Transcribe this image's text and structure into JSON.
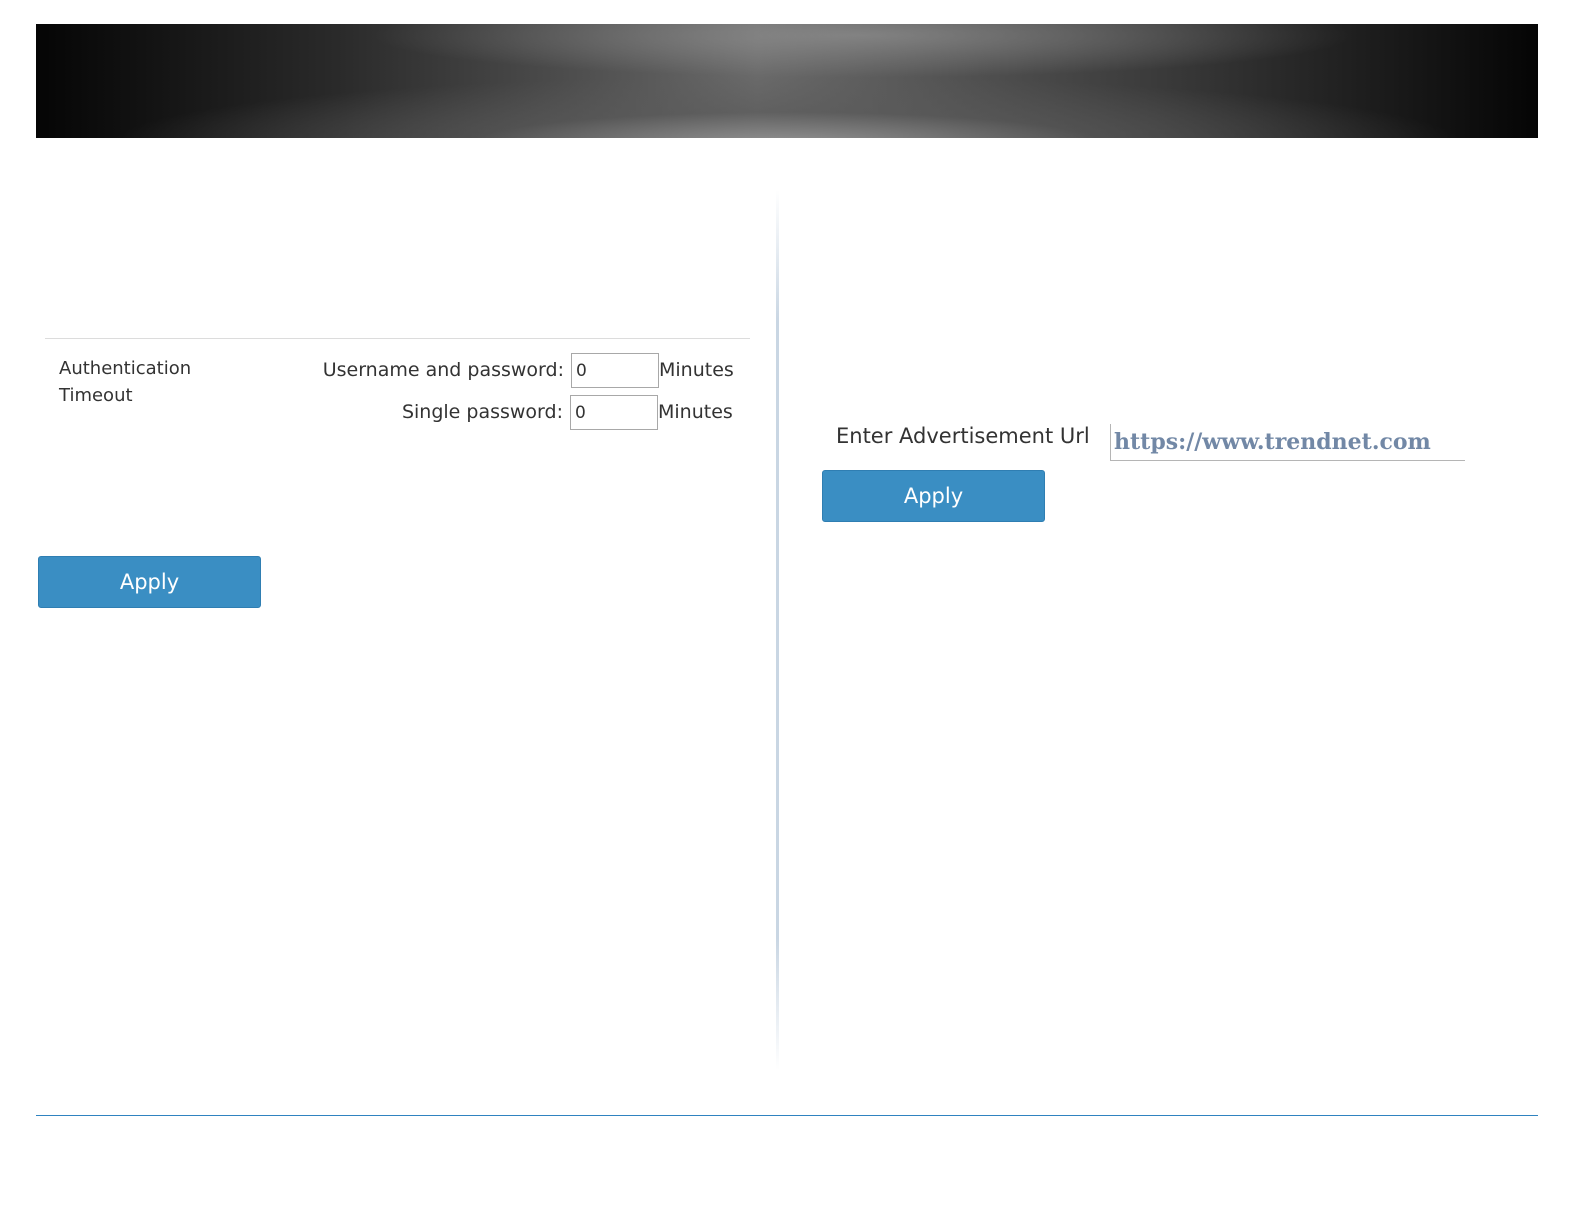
{
  "auth_timeout": {
    "section_label": "Authentication Timeout",
    "fields": [
      {
        "label": "Username and password:",
        "value": "0",
        "unit": "Minutes"
      },
      {
        "label": "Single password:",
        "value": "0",
        "unit": "Minutes"
      }
    ],
    "apply_label": "Apply"
  },
  "advertisement": {
    "url_label": "Enter Advertisement Url",
    "url_placeholder": "https://www.trendnet.com",
    "apply_label": "Apply"
  },
  "colors": {
    "button": "#3a8ec3",
    "footer_line": "#2f83c0",
    "placeholder_text": "#7288a6"
  }
}
